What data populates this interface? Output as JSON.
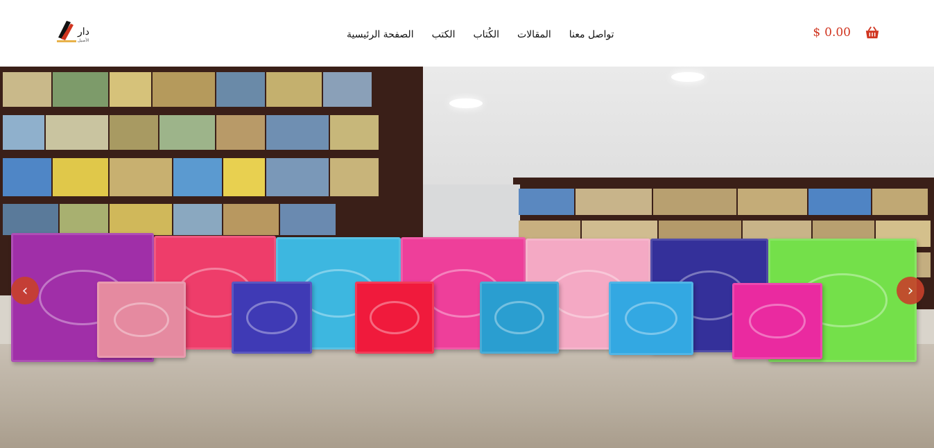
{
  "header": {
    "logo_icon": "dar-al-aseel-logo",
    "nav": [
      {
        "label": "الصفحة الرئيسية"
      },
      {
        "label": "الكتب"
      },
      {
        "label": "الكُتاب"
      },
      {
        "label": "المقالات"
      },
      {
        "label": "تواصل معنا"
      }
    ],
    "cart": {
      "currency": "$",
      "amount": "0.00",
      "icon": "basket-icon"
    }
  },
  "slider": {
    "prev_icon": "chevron-left-icon",
    "next_icon": "chevron-right-icon",
    "prev_label": "‹",
    "next_label": "›"
  },
  "colors": {
    "accent": "#d0341f",
    "arrow": "#c8402a",
    "quran_colors": [
      "#a02fa8",
      "#ee3d6a",
      "#3db7e0",
      "#ee3f9a",
      "#f4a9c4",
      "#34309a",
      "#74e04a",
      "#e58aa0",
      "#3f3ab5",
      "#f01a3c",
      "#2a9ed0",
      "#33a8e2",
      "#ea2aa0"
    ]
  }
}
